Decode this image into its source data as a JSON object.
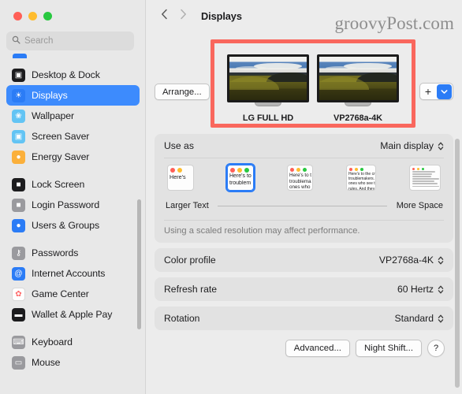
{
  "window": {
    "traffic_lights": [
      "close",
      "minimize",
      "zoom"
    ],
    "colors": {
      "accent": "#2b7cf6",
      "highlight_box": "#f9675d",
      "sidebar_bg": "#e8e8e8",
      "panel_bg": "#ececec",
      "card_bg": "#e2e2e2"
    }
  },
  "search": {
    "placeholder": "Search",
    "value": "",
    "icon": "search-icon"
  },
  "sidebar": {
    "groups": [
      {
        "items": [
          {
            "label": "Desktop & Dock",
            "icon": "desktop-dock-icon",
            "icon_class": "ic-desktop",
            "glyph": "▣",
            "selected": false
          },
          {
            "label": "Displays",
            "icon": "displays-icon",
            "icon_class": "ic-displays",
            "glyph": "☀",
            "selected": true
          },
          {
            "label": "Wallpaper",
            "icon": "wallpaper-icon",
            "icon_class": "ic-wallpaper",
            "glyph": "❀",
            "selected": false
          },
          {
            "label": "Screen Saver",
            "icon": "screen-saver-icon",
            "icon_class": "ic-screensaver",
            "glyph": "▣",
            "selected": false
          },
          {
            "label": "Energy Saver",
            "icon": "energy-saver-icon",
            "icon_class": "ic-energy",
            "glyph": "●",
            "selected": false
          }
        ]
      },
      {
        "items": [
          {
            "label": "Lock Screen",
            "icon": "lock-screen-icon",
            "icon_class": "ic-lock",
            "glyph": "■",
            "selected": false
          },
          {
            "label": "Login Password",
            "icon": "login-password-icon",
            "icon_class": "ic-loginpw",
            "glyph": "■",
            "selected": false
          },
          {
            "label": "Users & Groups",
            "icon": "users-groups-icon",
            "icon_class": "ic-users",
            "glyph": "●",
            "selected": false
          }
        ]
      },
      {
        "items": [
          {
            "label": "Passwords",
            "icon": "passwords-icon",
            "icon_class": "ic-passwords",
            "glyph": "⚷",
            "selected": false
          },
          {
            "label": "Internet Accounts",
            "icon": "internet-accounts-icon",
            "icon_class": "ic-internet",
            "glyph": "@",
            "selected": false
          },
          {
            "label": "Game Center",
            "icon": "game-center-icon",
            "icon_class": "ic-gamecenter",
            "glyph": "✿",
            "selected": false
          },
          {
            "label": "Wallet & Apple Pay",
            "icon": "wallet-apple-pay-icon",
            "icon_class": "ic-wallet",
            "glyph": "▬",
            "selected": false
          }
        ]
      },
      {
        "items": [
          {
            "label": "Keyboard",
            "icon": "keyboard-icon",
            "icon_class": "ic-keyboard",
            "glyph": "⌨",
            "selected": false
          },
          {
            "label": "Mouse",
            "icon": "mouse-icon",
            "icon_class": "ic-mouse",
            "glyph": "▭",
            "selected": false
          }
        ]
      }
    ]
  },
  "toolbar": {
    "back_icon": "chevron-left-icon",
    "forward_icon": "chevron-right-icon",
    "title": "Displays"
  },
  "watermark": {
    "text": "groovyPost.com"
  },
  "displays": {
    "arrange_label": "Arrange...",
    "add_plus": "+",
    "add_chevron_icon": "chevron-down-icon",
    "items": [
      {
        "name": "LG FULL HD"
      },
      {
        "name": "VP2768a-4K"
      }
    ]
  },
  "use_as": {
    "label": "Use as",
    "value": "Main display"
  },
  "resolution": {
    "caption_left": "Larger Text",
    "caption_right": "More Space",
    "note": "Using a scaled resolution may affect performance.",
    "options": [
      {
        "index": 0,
        "selected": false,
        "dots": 2,
        "lines": [
          "Here's"
        ]
      },
      {
        "index": 1,
        "selected": true,
        "dots": 3,
        "lines": [
          "Here's to",
          "troublem"
        ]
      },
      {
        "index": 2,
        "selected": false,
        "dots": 3,
        "lines": [
          "Here's to t",
          "troublema",
          "ones who"
        ]
      },
      {
        "index": 3,
        "selected": false,
        "dots": 3,
        "lines": [
          "Here's to the cr",
          "troublemakers.",
          "ones who see t",
          "rules. And they"
        ]
      },
      {
        "index": 4,
        "selected": false,
        "dots": 3,
        "lines": [
          "Here's to the crazy ones",
          "troublemakers. The rou",
          "ones who see things dif",
          "rules. And they have no",
          "can quote them, disagr",
          "them. About the only th",
          "because they change th"
        ]
      }
    ]
  },
  "settings_rows": [
    {
      "label": "Color profile",
      "value": "VP2768a-4K"
    },
    {
      "label": "Refresh rate",
      "value": "60 Hertz"
    },
    {
      "label": "Rotation",
      "value": "Standard"
    }
  ],
  "bottom_buttons": {
    "advanced": "Advanced...",
    "night_shift": "Night Shift...",
    "help": "?"
  }
}
